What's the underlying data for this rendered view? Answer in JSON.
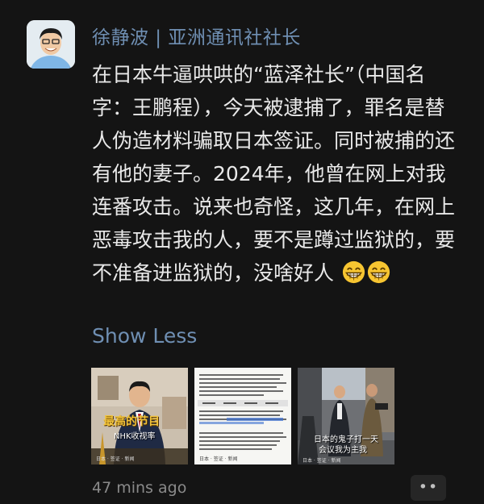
{
  "post": {
    "author": "徐静波 | 亚洲通讯社社长",
    "text": "在日本牛逼哄哄的“蓝泽社长”（中国名字：王鹏程），今天被逮捕了，罪名是替人伪造材料骗取日本签证。同时被捕的还有他的妻子。2024年，他曾在网上对我连番攻击。说来也奇怪，这几年，在网上恶毒攻击我的人，要不是蹲过监狱的，要不准备进监狱的，没啥好人",
    "emojis": [
      "grinning-face-icon",
      "grinning-face-icon"
    ],
    "show_less_label": "Show Less",
    "timestamp": "47 mins ago",
    "more_label": "••"
  },
  "images": [
    {
      "caption_top": "最高的节目",
      "caption_bottom": "NHK收视率",
      "footer": "日本 · 签证 · 新闻"
    },
    {
      "footer": "日本 · 签证 · 新闻"
    },
    {
      "caption_top": "日本的鬼子打一天",
      "caption_bottom": "会议我为主我",
      "footer": "日本 · 签证 · 新闻"
    }
  ],
  "colors": {
    "background": "#141414",
    "author": "#6f8fb3",
    "link": "#6f8fb3",
    "text": "#e9e9e9",
    "timestamp": "#8a8a8a"
  }
}
